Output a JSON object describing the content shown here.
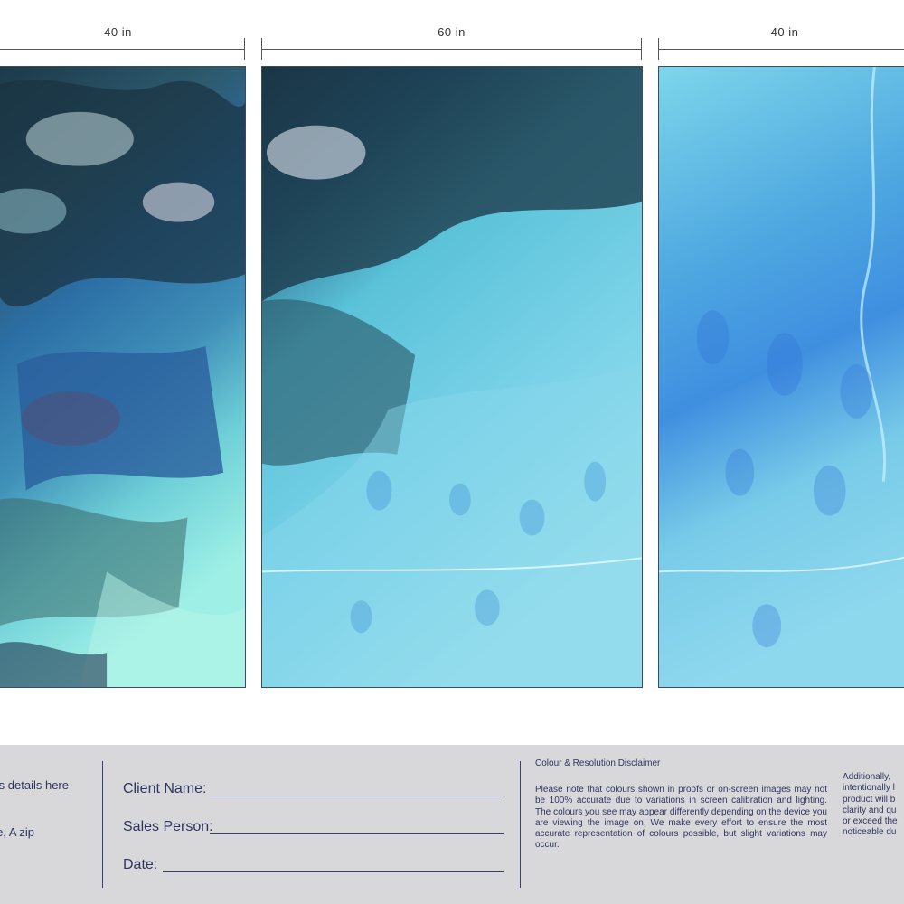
{
  "dimensions": [
    {
      "label": "40 in"
    },
    {
      "label": "60 in"
    },
    {
      "label": "40 in"
    }
  ],
  "panels": [
    {
      "alt": "blue onyx texture panel left"
    },
    {
      "alt": "blue onyx texture panel center"
    },
    {
      "alt": "blue onyx texture panel right"
    }
  ],
  "footer": {
    "contact_lines": [
      "s details here",
      "",
      "e, A zip"
    ],
    "fields": {
      "client": "Client Name:",
      "sales": "Sales Person:",
      "date": "Date:"
    },
    "disclaimer_title": "Colour & Resolution Disclaimer",
    "disclaimer_body": "Please note that colours shown in proofs or on-screen images may not be 100% accurate due to variations in screen calibration and lighting. The colours you see may appear differently depending on the device you are viewing the image on. We make every effort to ensure the most accurate representation of colours possible, but slight variations may occur.",
    "extra_lines": [
      "Additionally,",
      "intentionally l",
      "product will b",
      "clarity and qu",
      "or exceed the",
      "noticeable du"
    ]
  },
  "colors": {
    "panel_dark": "#0f2a3f",
    "panel_mid": "#2f7fbf",
    "panel_light": "#8fe0ea",
    "footer_bg": "#d8d8da",
    "text": "#2f3561"
  }
}
